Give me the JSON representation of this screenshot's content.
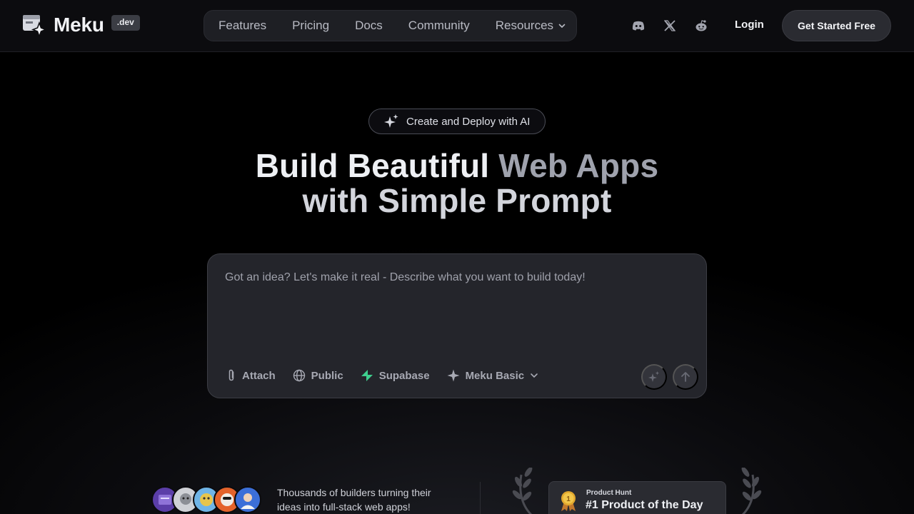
{
  "brand": {
    "name": "Meku",
    "badge": ".dev"
  },
  "nav": {
    "links": [
      "Features",
      "Pricing",
      "Docs",
      "Community",
      "Resources"
    ],
    "social_icons": [
      "discord-icon",
      "x-icon",
      "reddit-icon"
    ],
    "login": "Login",
    "cta": "Get Started Free"
  },
  "hero": {
    "chip": "Create and Deploy with AI",
    "headline": {
      "line1_a": "Build Beautiful",
      "line1_b": "Web Apps",
      "line2_a": "with Simple Prompt"
    }
  },
  "prompt": {
    "placeholder": "Got an idea? Let's make it real - Describe what you want to build today!",
    "value": "",
    "tools": {
      "attach": "Attach",
      "visibility": "Public",
      "integration": "Supabase",
      "model": "Meku Basic"
    }
  },
  "bottom": {
    "social_proof": "Thousands of builders turning their ideas into full-stack web apps!",
    "product_hunt": {
      "label": "Product Hunt",
      "title": "#1 Product of the Day",
      "rank": "1"
    }
  },
  "colors": {
    "background": "#000000",
    "panel": "#24252b",
    "accent_green": "#3ecf8e",
    "medal_gold": "#e2a82e"
  }
}
